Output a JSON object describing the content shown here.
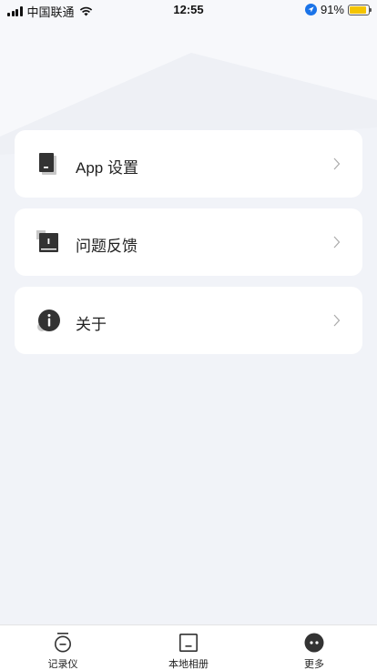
{
  "status_bar": {
    "carrier": "中国联通",
    "time": "12:55",
    "battery_percent": "91%",
    "battery_level": 0.91,
    "icons": [
      "signal-icon",
      "wifi-icon",
      "location-arrow-icon",
      "battery-icon"
    ]
  },
  "menu": {
    "items": [
      {
        "label": "App 设置",
        "icon": "device-icon"
      },
      {
        "label": "问题反馈",
        "icon": "feedback-icon"
      },
      {
        "label": "关于",
        "icon": "info-icon"
      }
    ]
  },
  "tabbar": {
    "tabs": [
      {
        "label": "记录仪",
        "icon": "recorder-icon"
      },
      {
        "label": "本地相册",
        "icon": "album-icon"
      },
      {
        "label": "更多",
        "icon": "more-icon",
        "active": true
      }
    ]
  },
  "colors": {
    "background": "#f1f3f8",
    "card": "#ffffff",
    "icon_dark": "#333333",
    "battery": "#f4c400",
    "location": "#1a73e8"
  }
}
